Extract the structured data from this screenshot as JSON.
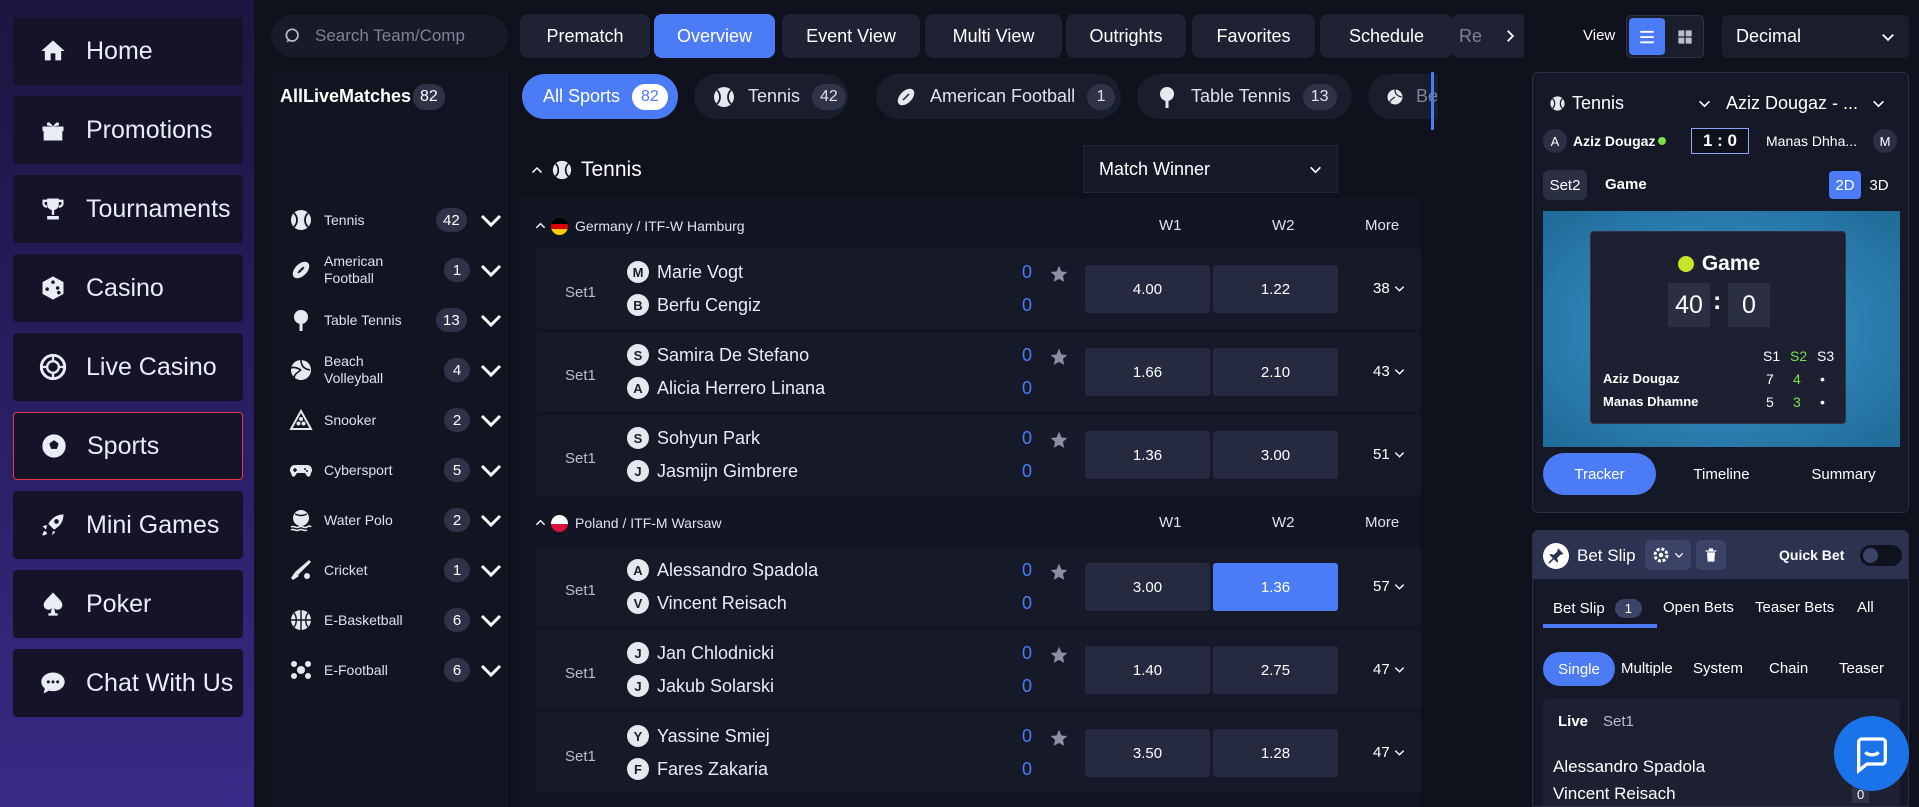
{
  "nav": {
    "items": [
      {
        "label": "Home",
        "icon": "home-icon"
      },
      {
        "label": "Promotions",
        "icon": "gift-icon"
      },
      {
        "label": "Tournaments",
        "icon": "trophy-icon"
      },
      {
        "label": "Casino",
        "icon": "dice-icon"
      },
      {
        "label": "Live Casino",
        "icon": "chip-icon"
      },
      {
        "label": "Sports",
        "icon": "soccer-ball-icon"
      },
      {
        "label": "Mini Games",
        "icon": "rocket-icon"
      },
      {
        "label": "Poker",
        "icon": "spade-icon"
      },
      {
        "label": "Chat With Us",
        "icon": "chat-icon"
      }
    ],
    "active": "Sports",
    "active_color": "#e53a4d"
  },
  "search": {
    "placeholder": "Search Team/Comp"
  },
  "top_tabs": [
    {
      "label": "Prematch"
    },
    {
      "label": "Overview"
    },
    {
      "label": "Event View"
    },
    {
      "label": "Multi View"
    },
    {
      "label": "Outrights"
    },
    {
      "label": "Favorites"
    },
    {
      "label": "Schedule"
    },
    {
      "label": "Re"
    }
  ],
  "top_active": "Overview",
  "view": {
    "label": "View",
    "odds_format": "Decimal"
  },
  "sidebar": {
    "title": "AllLiveMatches",
    "total": "82",
    "sports": [
      {
        "name": "Tennis",
        "count": "42",
        "icon": "tennis-icon"
      },
      {
        "name": "American Football",
        "count": "1",
        "icon": "american-football-icon"
      },
      {
        "name": "Table Tennis",
        "count": "13",
        "icon": "table-tennis-icon"
      },
      {
        "name": "Beach Volleyball",
        "count": "4",
        "icon": "volleyball-icon"
      },
      {
        "name": "Snooker",
        "count": "2",
        "icon": "snooker-icon"
      },
      {
        "name": "Cybersport",
        "count": "5",
        "icon": "gamepad-icon"
      },
      {
        "name": "Water Polo",
        "count": "2",
        "icon": "water-polo-icon"
      },
      {
        "name": "Cricket",
        "count": "1",
        "icon": "cricket-icon"
      },
      {
        "name": "E-Basketball",
        "count": "6",
        "icon": "basketball-icon"
      },
      {
        "name": "E-Football",
        "count": "6",
        "icon": "football-icon"
      }
    ]
  },
  "sport_pills": [
    {
      "label": "All Sports",
      "count": "82"
    },
    {
      "label": "Tennis",
      "count": "42"
    },
    {
      "label": "American Football",
      "count": "1"
    },
    {
      "label": "Table Tennis",
      "count": "13"
    },
    {
      "label": "Be",
      "count": ""
    }
  ],
  "section": {
    "title": "Tennis",
    "market": "Match Winner"
  },
  "leagues": [
    {
      "name": "Germany / ITF-W Hamburg",
      "flag_colors": [
        "#000000",
        "#dd0000",
        "#ffce00"
      ],
      "col1": "W1",
      "col2": "W2",
      "col3": "More",
      "matches": [
        {
          "set": "Set1",
          "p1": "Marie Vogt",
          "b1": "M",
          "s1": "0",
          "p2": "Berfu Cengiz",
          "b2": "B",
          "s2": "0",
          "w1": "4.00",
          "w2": "1.22",
          "more": "38"
        },
        {
          "set": "Set1",
          "p1": "Samira De Stefano",
          "b1": "S",
          "s1": "0",
          "p2": "Alicia Herrero Linana",
          "b2": "A",
          "s2": "0",
          "w1": "1.66",
          "w2": "2.10",
          "more": "43"
        },
        {
          "set": "Set1",
          "p1": "Sohyun Park",
          "b1": "S",
          "s1": "0",
          "p2": "Jasmijn Gimbrere",
          "b2": "J",
          "s2": "0",
          "w1": "1.36",
          "w2": "3.00",
          "more": "51"
        }
      ]
    },
    {
      "name": "Poland / ITF-M Warsaw",
      "flag_colors": [
        "#ffffff",
        "#dc143c"
      ],
      "col1": "W1",
      "col2": "W2",
      "col3": "More",
      "matches": [
        {
          "set": "Set1",
          "p1": "Alessandro Spadola",
          "b1": "A",
          "s1": "0",
          "p2": "Vincent Reisach",
          "b2": "V",
          "s2": "0",
          "w1": "3.00",
          "w2": "1.36",
          "more": "57",
          "selected": "w2"
        },
        {
          "set": "Set1",
          "p1": "Jan Chlodnicki",
          "b1": "J",
          "s1": "0",
          "p2": "Jakub Solarski",
          "b2": "J",
          "s2": "0",
          "w1": "1.40",
          "w2": "2.75",
          "more": "47"
        },
        {
          "set": "Set1",
          "p1": "Yassine Smiej",
          "b1": "Y",
          "s1": "0",
          "p2": "Fares Zakaria",
          "b2": "F",
          "s2": "0",
          "w1": "3.50",
          "w2": "1.28",
          "more": "47"
        }
      ]
    }
  ],
  "tracker": {
    "sport": "Tennis",
    "match": "Aziz Dougaz - ...",
    "home": "Aziz Dougaz",
    "home_badge": "A",
    "away": "Manas Dhha...",
    "away_badge": "M",
    "score": "1 : 0",
    "set_label": "Set2",
    "game_label": "Game",
    "view_2d": "2D",
    "view_3d": "3D",
    "board_title": "Game",
    "board_p1": "40",
    "board_sep": ":",
    "board_p2": "0",
    "headers": [
      "S1",
      "S2",
      "S3"
    ],
    "rows": [
      {
        "name": "Aziz Dougaz",
        "s1": "7",
        "s2": "4",
        "s3": "•"
      },
      {
        "name": "Manas Dhamne",
        "s1": "5",
        "s2": "3",
        "s3": "•"
      }
    ],
    "tabs": [
      "Tracker",
      "Timeline",
      "Summary"
    ],
    "active_tab": "Tracker"
  },
  "betslip": {
    "title": "Bet Slip",
    "quick_bet": "Quick Bet",
    "tabs": [
      {
        "label": "Bet Slip",
        "count": "1"
      },
      {
        "label": "Open Bets"
      },
      {
        "label": "Teaser Bets"
      },
      {
        "label": "All"
      }
    ],
    "types": [
      "Single",
      "Multiple",
      "System",
      "Chain",
      "Teaser"
    ],
    "active_type": "Single",
    "live": "Live",
    "set": "Set1",
    "p1": "Alessandro Spadola",
    "p2": "Vincent Reisach",
    "p2_score": "0"
  },
  "colors": {
    "accent": "#4c7cf5",
    "bg": "#0f111c",
    "row": "#161928",
    "odd": "#252a40",
    "green": "#7be04a"
  }
}
